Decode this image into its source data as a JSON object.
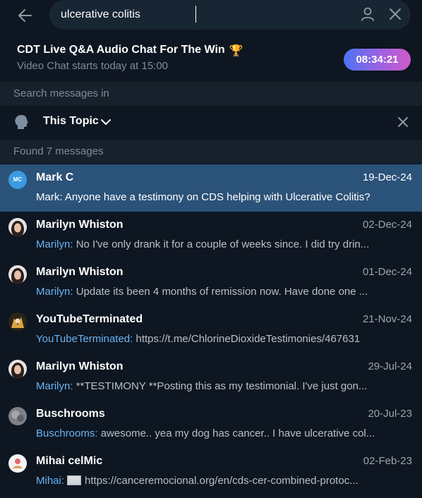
{
  "search": {
    "value": "ulcerative colitis",
    "icons": {
      "back": "arrow-left-icon",
      "user": "user-icon",
      "clear": "close-icon"
    }
  },
  "video_chat": {
    "title": "CDT Live Q&A Audio Chat For The Win",
    "trophy": "🏆",
    "subtitle": "Video Chat starts today at 15:00",
    "timer": "08:34:21",
    "timer_colors": [
      "#4b74f2",
      "#d05cc8"
    ]
  },
  "search_in": {
    "label": "Search messages in",
    "topic": "This Topic"
  },
  "found": {
    "label": "Found 7 messages"
  },
  "results": [
    {
      "name": "Mark C",
      "date": "19-Dec-24",
      "sender": "",
      "text": "Mark: Anyone have a testimony on CDS helping with Ulcerative Colitis?",
      "initials": "MC",
      "active": true
    },
    {
      "name": "Marilyn Whiston",
      "date": "02-Dec-24",
      "sender": "Marilyn:",
      "text": "No I've only drank it for a couple of weeks since. I did try drin..."
    },
    {
      "name": "Marilyn Whiston",
      "date": "01-Dec-24",
      "sender": "Marilyn:",
      "text": "Update its been 4 months of remission now. Have done one ..."
    },
    {
      "name": "YouTubeTerminated",
      "date": "21-Nov-24",
      "sender": "YouTubeTerminated:",
      "text": "https://t.me/ChlorineDioxideTestimonies/467631"
    },
    {
      "name": "Marilyn Whiston",
      "date": "29-Jul-24",
      "sender": "Marilyn:",
      "text": "**TESTIMONY **Posting this as my testimonial. I've just gon..."
    },
    {
      "name": "Buschrooms",
      "date": "20-Jul-23",
      "sender": "Buschrooms:",
      "text": "awesome.. yea my dog has cancer.. I have ulcerative col..."
    },
    {
      "name": "Mihai celMic",
      "date": "02-Feb-23",
      "sender": "Mihai:",
      "text": "https://canceremocional.org/en/cds-cer-combined-protoc..."
    }
  ],
  "colors": {
    "bg": "#0e1621",
    "section_bg": "#17212b",
    "active_row": "#2b5278",
    "accent": "#6ab3f3",
    "muted": "#7d8b99"
  }
}
